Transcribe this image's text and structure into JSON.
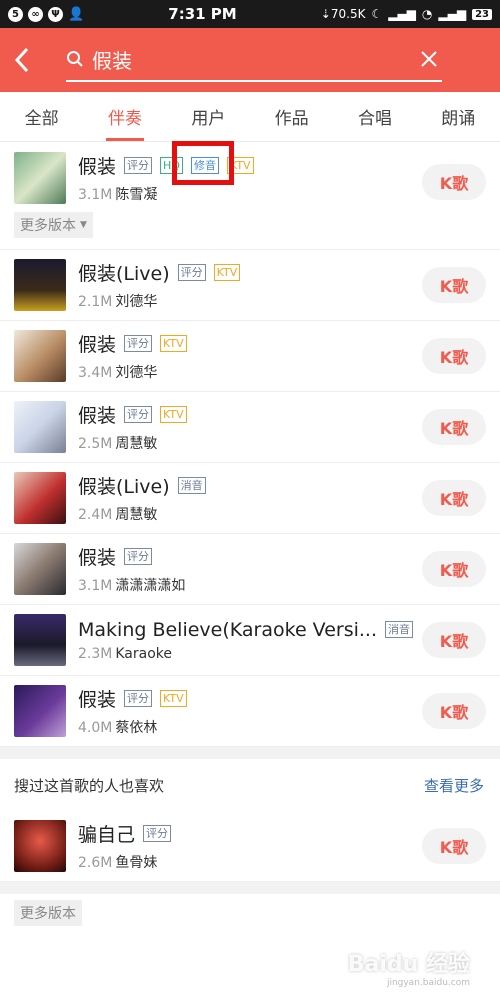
{
  "status": {
    "time": "7:31 PM",
    "speed": "70.5K",
    "battery": "23"
  },
  "search": {
    "query": "假装"
  },
  "tabs": [
    "全部",
    "伴奏",
    "用户",
    "作品",
    "合唱",
    "朗诵"
  ],
  "k_label": "K歌",
  "songs": [
    {
      "title": "假装",
      "tags": [
        "评分",
        "HQ",
        "修音",
        "KTV"
      ],
      "size": "3.1M",
      "artist": "陈雪凝",
      "more": "更多版本"
    },
    {
      "title": "假装(Live)",
      "tags": [
        "评分",
        "KTV"
      ],
      "size": "2.1M",
      "artist": "刘德华"
    },
    {
      "title": "假装",
      "tags": [
        "评分",
        "KTV"
      ],
      "size": "3.4M",
      "artist": "刘德华"
    },
    {
      "title": "假装",
      "tags": [
        "评分",
        "KTV"
      ],
      "size": "2.5M",
      "artist": "周慧敏"
    },
    {
      "title": "假装(Live)",
      "tags": [
        "消音"
      ],
      "size": "2.4M",
      "artist": "周慧敏"
    },
    {
      "title": "假装",
      "tags": [
        "评分"
      ],
      "size": "3.1M",
      "artist": "潇潇潇潇如"
    },
    {
      "title": "Making Believe(Karaoke Versi...",
      "tags": [
        "消音"
      ],
      "size": "2.3M",
      "artist": "Karaoke"
    },
    {
      "title": "假装",
      "tags": [
        "评分",
        "KTV"
      ],
      "size": "4.0M",
      "artist": "蔡依林"
    }
  ],
  "recommend": {
    "title": "搜过这首歌的人也喜欢",
    "more": "查看更多",
    "song": {
      "title": "骗自己",
      "tags": [
        "评分"
      ],
      "size": "2.6M",
      "artist": "鱼骨妹"
    },
    "more_versions": "更多版本"
  },
  "watermark": {
    "main": "Baidu 经验",
    "sub": "jingyan.baidu.com"
  },
  "colors": {
    "accent": "#f15b4e",
    "link": "#3a6db0",
    "highlight_box": "#e41010"
  }
}
